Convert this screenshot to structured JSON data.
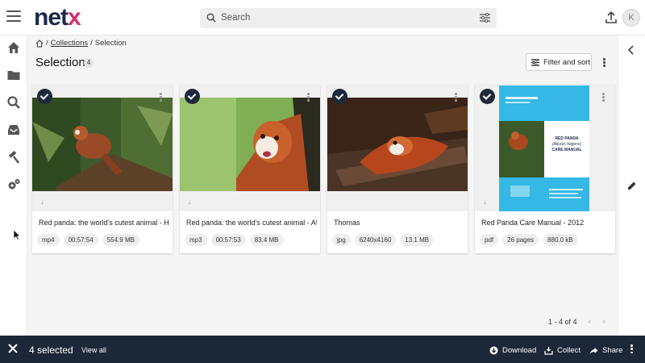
{
  "header": {
    "logo_main": "net",
    "logo_accent": "x",
    "search_placeholder": "Search",
    "avatar_initial": "K"
  },
  "breadcrumb": {
    "separator": "/",
    "collections": "Collections",
    "current": "Selection"
  },
  "page": {
    "title": "Selection",
    "count": "4",
    "filter_label": "Filter and sort"
  },
  "cards": [
    {
      "name": "Red panda: the world's cutest animal - HD ...",
      "format": "mp4",
      "duration": "00:57:54",
      "size": "554.9 MB"
    },
    {
      "name": "Red panda: the world's cutest animal - AU...",
      "format": "mp3",
      "duration": "00:57:53",
      "size": "83.4 MB"
    },
    {
      "name": "Thomas",
      "format": "jpg",
      "dimensions": "6240x4160",
      "size": "13.1 MB"
    },
    {
      "name": "Red Panda Care Manual - 2012",
      "format": "pdf",
      "pages": "26 pages",
      "size": "880.0 kB"
    }
  ],
  "pdf_cover": {
    "title_line1": "RED PANDA",
    "title_line2": "(Ailurus fulgens)",
    "title_line3": "CARE MANUAL"
  },
  "pagination": {
    "range": "1 - 4 of 4"
  },
  "bottom_bar": {
    "selected": "4 selected",
    "view_all": "View all",
    "download": "Download",
    "collect": "Collect",
    "share": "Share"
  },
  "colors": {
    "brand_dark": "#1b2a4a",
    "brand_accent": "#d62d6f",
    "bottom_bar": "#1c2738",
    "pdf_cover_blue": "#35b8e6"
  }
}
